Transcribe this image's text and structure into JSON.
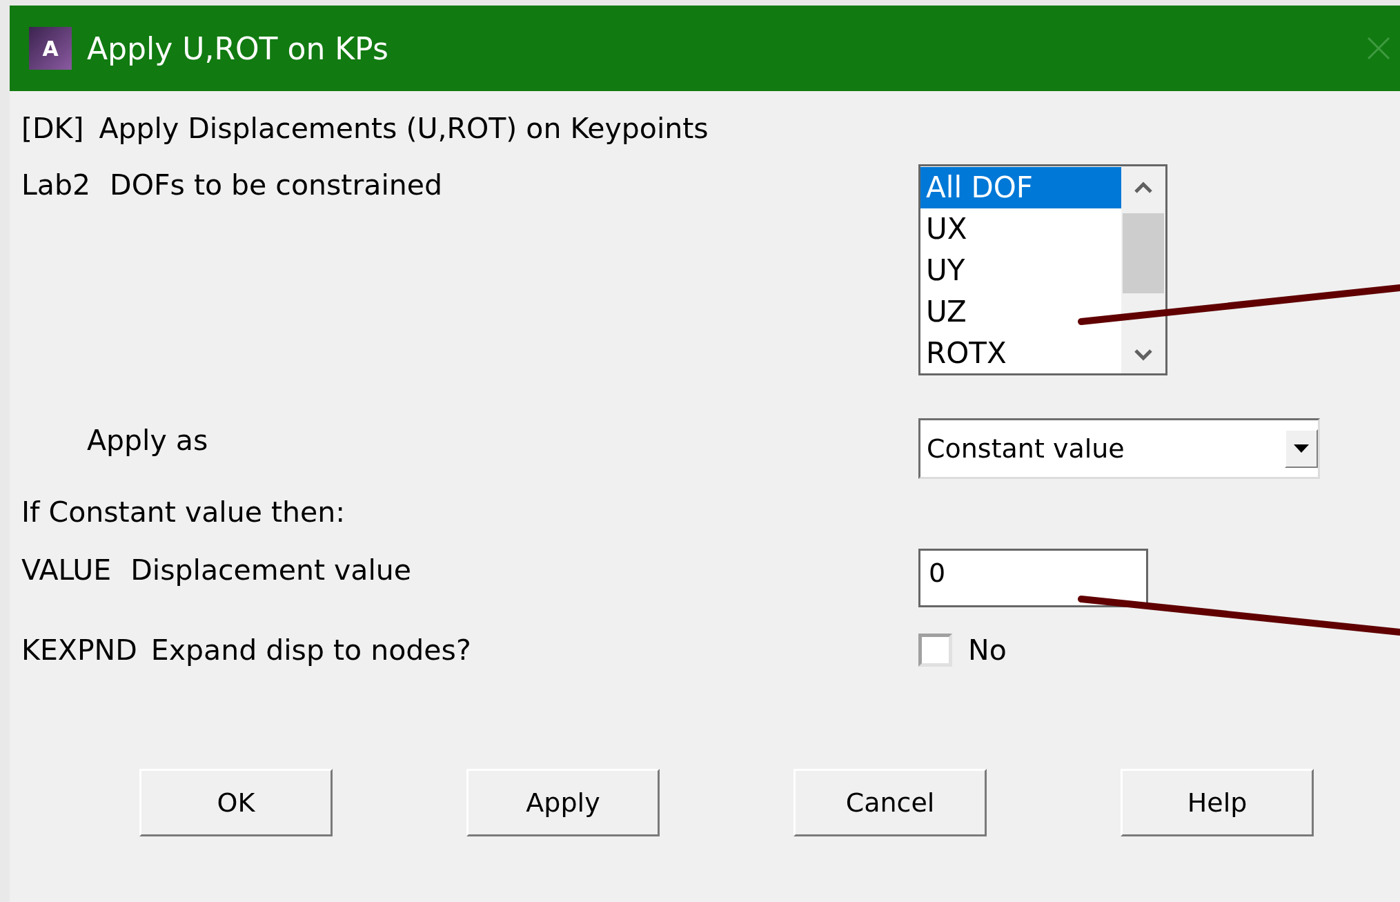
{
  "window": {
    "icon_letter": "A",
    "title": "Apply U,ROT on KPs",
    "close_enabled": false
  },
  "header": {
    "code": "[DK]",
    "text": "Apply Displacements (U,ROT) on Keypoints"
  },
  "rows": [
    {
      "kind": "listbox",
      "key": "Lab2",
      "label": "DOFs to be constrained",
      "items": [
        {
          "label": "All DOF",
          "selected": true
        },
        {
          "label": "UX",
          "selected": false
        },
        {
          "label": "UY",
          "selected": false
        },
        {
          "label": "UZ",
          "selected": false
        },
        {
          "label": "ROTX",
          "selected": false
        }
      ]
    },
    {
      "kind": "dropdown",
      "label": "Apply as",
      "value": "Constant value"
    },
    {
      "kind": "note",
      "label": "If Constant value then:"
    },
    {
      "kind": "text",
      "key": "VALUE",
      "label": "Displacement value",
      "value": "0"
    },
    {
      "kind": "checkbox",
      "key": "KEXPND",
      "label": "Expand disp to nodes?",
      "checked": false,
      "text": "No"
    }
  ],
  "buttons": [
    "OK",
    "Apply",
    "Cancel",
    "Help"
  ]
}
